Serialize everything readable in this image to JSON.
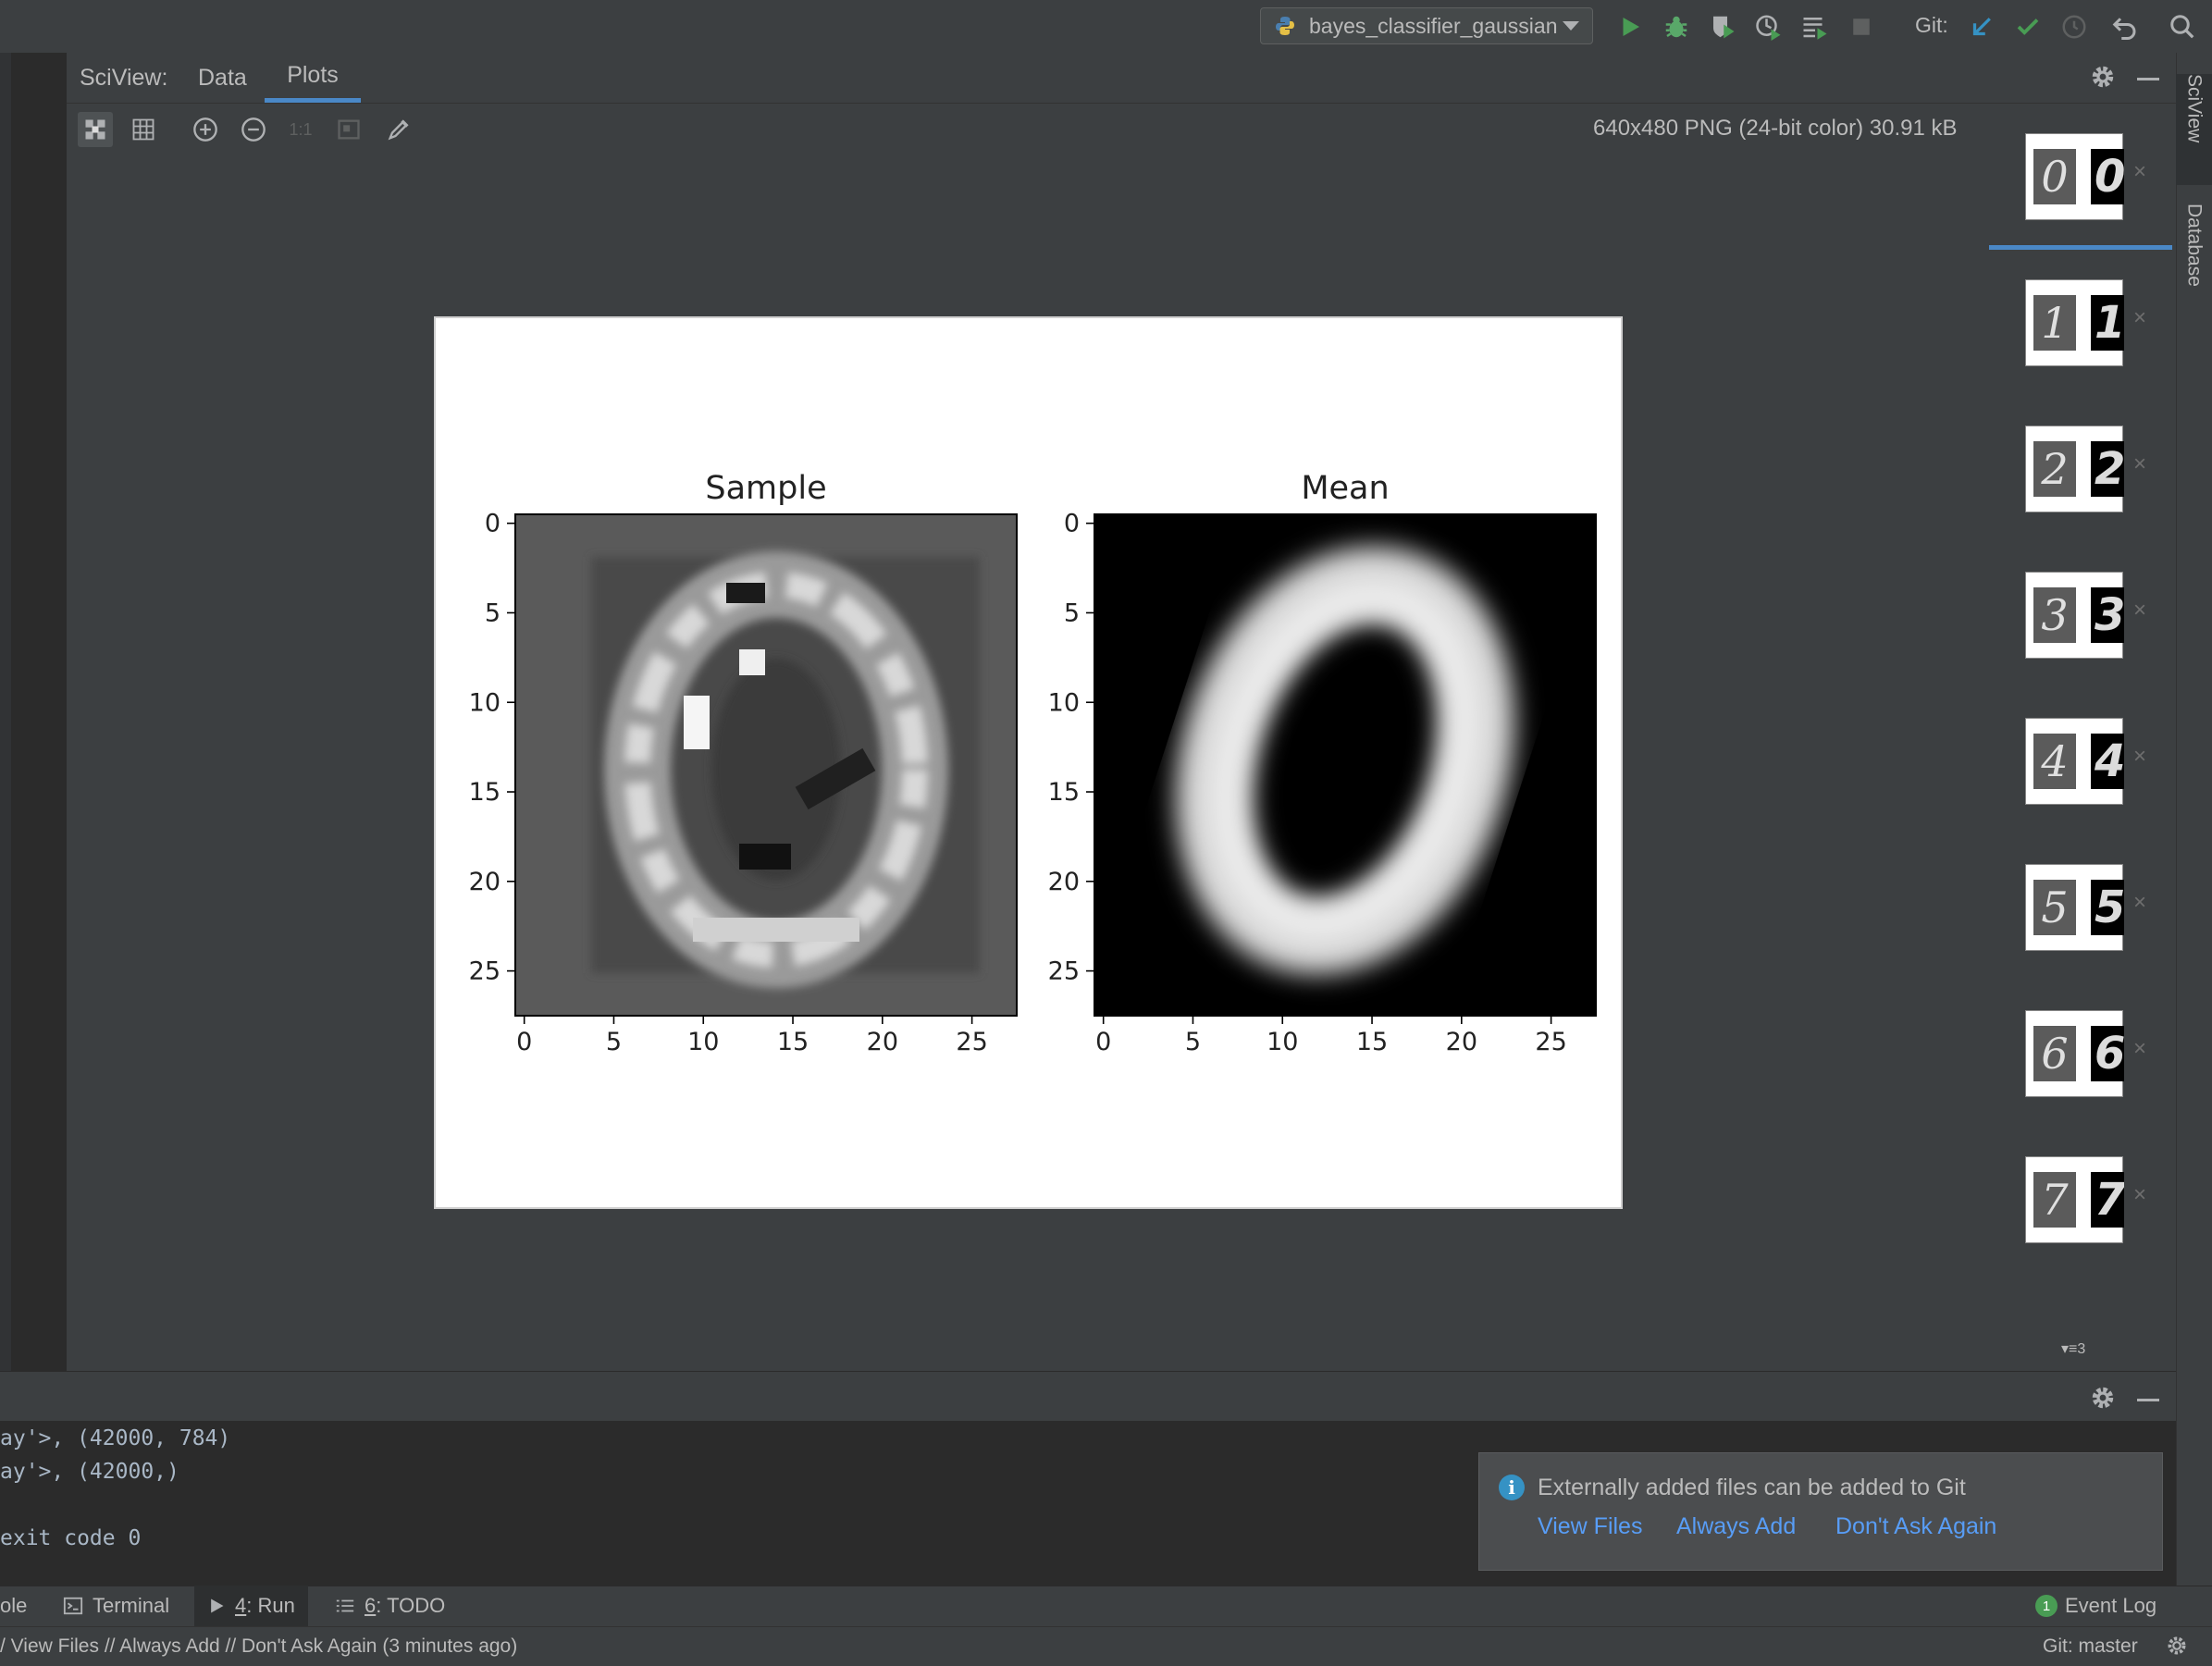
{
  "toolbar": {
    "run_config": "bayes_classifier_gaussian",
    "git_label": "Git:"
  },
  "sciview": {
    "title": "SciView:",
    "tabs": [
      {
        "label": "Data",
        "active": false
      },
      {
        "label": "Plots",
        "active": true
      }
    ],
    "plot_toolbar": {
      "one_to_one": "1:1"
    },
    "image_info": "640x480 PNG (24-bit color) 30.91 kB"
  },
  "plot": {
    "subplots": [
      {
        "title": "Sample",
        "xticks": [
          "0",
          "5",
          "10",
          "15",
          "20",
          "25"
        ],
        "yticks": [
          "0",
          "5",
          "10",
          "15",
          "20",
          "25"
        ]
      },
      {
        "title": "Mean",
        "xticks": [
          "0",
          "5",
          "10",
          "15",
          "20",
          "25"
        ],
        "yticks": [
          "0",
          "5",
          "10",
          "15",
          "20",
          "25"
        ]
      }
    ]
  },
  "thumbnails": [
    {
      "digit": "0"
    },
    {
      "digit": "1"
    },
    {
      "digit": "2"
    },
    {
      "digit": "3"
    },
    {
      "digit": "4"
    },
    {
      "digit": "5"
    },
    {
      "digit": "6"
    },
    {
      "digit": "7"
    }
  ],
  "thumbnail_count": "3",
  "right_tabs": {
    "sciview": "SciView",
    "database": "Database"
  },
  "console": {
    "lines": [
      "ay'>, (42000, 784)",
      "ay'>, (42000,)",
      "",
      "exit code 0"
    ]
  },
  "notification": {
    "message": "Externally added files can be added to Git",
    "links": [
      "View Files",
      "Always Add",
      "Don't Ask Again"
    ]
  },
  "bottom_tabs": {
    "console": "ole",
    "terminal": "Terminal",
    "run_num": "4",
    "run_label": ": Run",
    "todo_num": "6",
    "todo_label": ": TODO",
    "event_log": "Event Log",
    "event_log_count": "1"
  },
  "status": {
    "message": "/ View Files // Always Add // Don't Ask Again (3 minutes ago)",
    "git_branch": "Git: master"
  },
  "colors": {
    "accent": "#4a88c7",
    "link": "#589df6",
    "run_green": "#499c54",
    "debug_green": "#59a869"
  }
}
